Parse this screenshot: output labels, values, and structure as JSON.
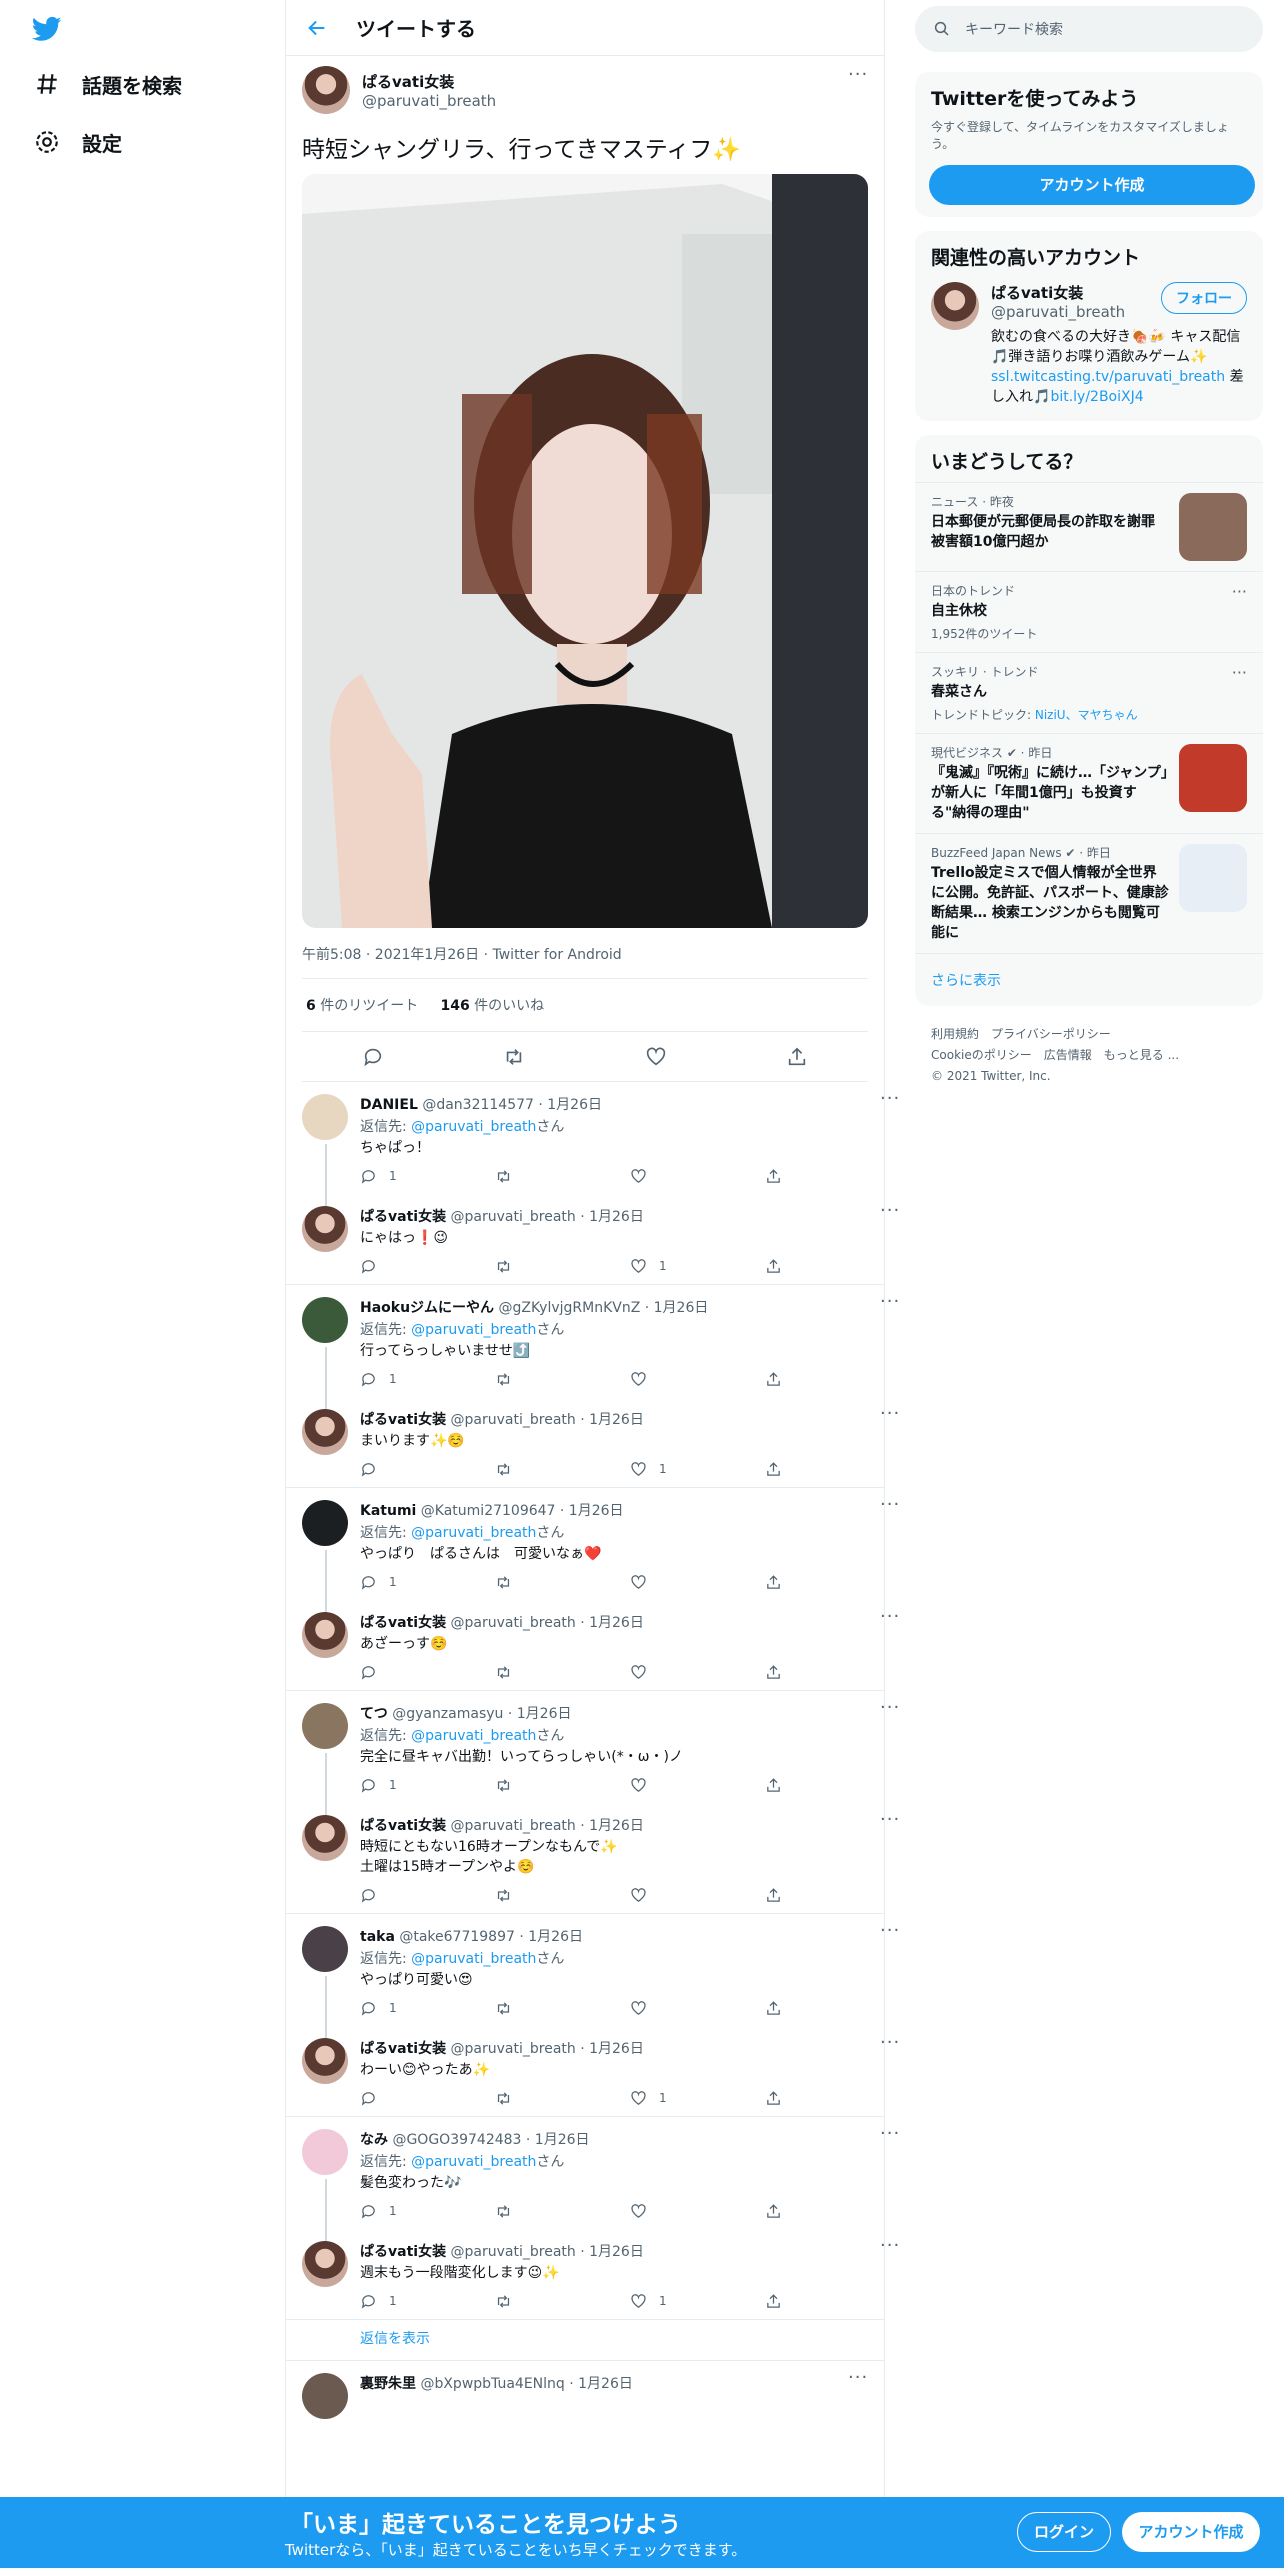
{
  "nav": {
    "search_label": "話題を検索",
    "settings_label": "設定"
  },
  "header": {
    "title": "ツイートする"
  },
  "tweet": {
    "name": "ぱるvati女装",
    "handle": "@paruvati_breath",
    "text": "時短シャングリラ、行ってきマスティフ✨",
    "meta": "午前5:08 · 2021年1月26日 · Twitter for Android",
    "retweets": "6",
    "retweets_label": " 件のリツイート",
    "likes": "146",
    "likes_label": " 件のいいね"
  },
  "replies": [
    {
      "name": "DANIEL",
      "handle": "@dan32114577 · 1月26日",
      "to": "@paruvati_breath",
      "text": "ちゃぱっ！",
      "replies": "1",
      "likes": "",
      "avatar": "#e8d7c0"
    },
    {
      "name": "ぱるvati女装",
      "handle": "@paruvati_breath · 1月26日",
      "to": "",
      "text": "にゃはっ❗😉",
      "replies": "",
      "likes": "1",
      "avatar": "self"
    },
    {
      "name": "Haokuジムにーやん",
      "handle": "@gZKylvjgRMnKVnZ · 1月26日",
      "to": "@paruvati_breath",
      "text": "行ってらっしゃいませせ⤴️",
      "replies": "1",
      "likes": "",
      "avatar": "#3b5a3a"
    },
    {
      "name": "ぱるvati女装",
      "handle": "@paruvati_breath · 1月26日",
      "to": "",
      "text": "まいります✨☺️",
      "replies": "",
      "likes": "1",
      "avatar": "self"
    },
    {
      "name": "Katumi",
      "handle": "@Katumi27109647 · 1月26日",
      "to": "@paruvati_breath",
      "text": "やっぱり　ぱるさんは　可愛いなぁ❤️",
      "replies": "1",
      "likes": "",
      "avatar": "#1b1f22"
    },
    {
      "name": "ぱるvati女装",
      "handle": "@paruvati_breath · 1月26日",
      "to": "",
      "text": "あざーっす☺️",
      "replies": "",
      "likes": "",
      "avatar": "self"
    },
    {
      "name": "てつ",
      "handle": "@gyanzamasyu · 1月26日",
      "to": "@paruvati_breath",
      "text": "完全に昼キャバ出勤！いってらっしゃい(*・ω・)ノ",
      "replies": "1",
      "likes": "",
      "avatar": "#8a7660"
    },
    {
      "name": "ぱるvati女装",
      "handle": "@paruvati_breath · 1月26日",
      "to": "",
      "text": "時短にともない16時オープンなもんで✨",
      "text2": "土曜は15時オープンやよ☺️",
      "replies": "",
      "likes": "",
      "avatar": "self"
    },
    {
      "name": "taka",
      "handle": "@take67719897 · 1月26日",
      "to": "@paruvati_breath",
      "text": "やっぱり可愛い😍",
      "replies": "1",
      "likes": "",
      "avatar": "#4a4048"
    },
    {
      "name": "ぱるvati女装",
      "handle": "@paruvati_breath · 1月26日",
      "to": "",
      "text": "わーい😊やったあ✨",
      "replies": "",
      "likes": "1",
      "avatar": "self"
    },
    {
      "name": "なみ",
      "handle": "@GOGO39742483 · 1月26日",
      "to": "@paruvati_breath",
      "text": "髪色変わった🎶",
      "replies": "1",
      "likes": "",
      "avatar": "#f2c9d8"
    },
    {
      "name": "ぱるvati女装",
      "handle": "@paruvati_breath · 1月26日",
      "to": "",
      "text": "週末もう一段階変化します😉✨",
      "replies": "1",
      "likes": "1",
      "avatar": "self"
    },
    {
      "name": "裏野朱里",
      "handle": "@bXpwpbTua4ENlnq · 1月26日",
      "to": "",
      "text": "",
      "replies": "",
      "likes": "",
      "avatar": "#6a5a50"
    }
  ],
  "reply_to_prefix": "返信先: ",
  "reply_to_suffix": "さん",
  "show_replies": "返信を表示",
  "search": {
    "placeholder": "キーワード検索"
  },
  "signup_card": {
    "title": "Twitterを使ってみよう",
    "sub": "今すぐ登録して、タイムラインをカスタマイズしましょう。",
    "button": "アカウント作成"
  },
  "related": {
    "title": "関連性の高いアカウント",
    "name": "ぱるvati女装",
    "handle": "@paruvati_breath",
    "follow": "フォロー",
    "bio1": "飲むの食べるの大好き🍖🍻 キャス配信🎵弾き語りお喋り酒飲みゲーム✨",
    "link1": "ssl.twitcasting.tv/paruvati_breath",
    "bio2": " 差し入れ🎵",
    "link2": "bit.ly/2BoiXJ4"
  },
  "trends": {
    "title": "いまどうしてる？",
    "items": [
      {
        "cat": "ニュース · 昨夜",
        "title": "日本郵便が元郵便局長の詐取を謝罪 被害額10億円超か",
        "meta": "",
        "thumb": "#8a6a5a"
      },
      {
        "cat": "日本のトレンド",
        "title": "自主休校",
        "meta": "1,952件のツイート",
        "thumb": ""
      },
      {
        "cat": "スッキリ · トレンド",
        "title": "春菜さん",
        "meta": "トレンドトピック: ",
        "meta_links": "NiziU、マヤちゃん",
        "thumb": ""
      },
      {
        "cat": "現代ビジネス ✔ · 昨日",
        "title": "『鬼滅』『呪術』に続け…「ジャンプ」が新人に「年間1億円」も投資する\"納得の理由\"",
        "meta": "",
        "thumb": "#c23a2a"
      },
      {
        "cat": "BuzzFeed Japan News ✔ · 昨日",
        "title": "Trello設定ミスで個人情報が全世界に公開。免許証、パスポート、健康診断結果… 検索エンジンからも閲覧可能に",
        "meta": "",
        "thumb": "#e8eef6"
      }
    ],
    "show_more": "さらに表示"
  },
  "footer": {
    "l1": [
      "利用規約",
      "プライバシーポリシー"
    ],
    "l2": [
      "Cookieのポリシー",
      "広告情報",
      "もっと見る ..."
    ],
    "copyright": "© 2021 Twitter, Inc."
  },
  "banner": {
    "title": "「いま」起きていることを見つけよう",
    "sub": "Twitterなら、「いま」起きていることをいち早くチェックできます。",
    "login": "ログイン",
    "signup": "アカウント作成"
  },
  "colors": {
    "accent": "#1d9bf0",
    "text": "#0f1419",
    "muted": "#536471"
  }
}
